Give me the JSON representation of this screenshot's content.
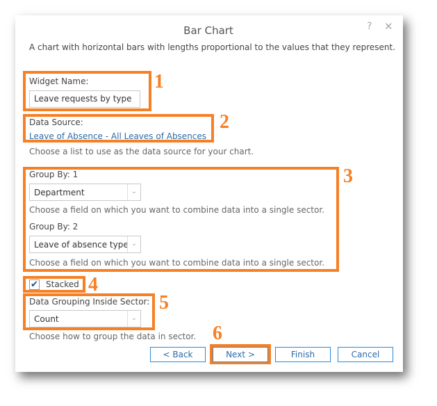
{
  "dialog": {
    "title": "Bar Chart",
    "description": "A chart with horizontal bars with lengths proportional to the values that they represent.",
    "help_icon": "?",
    "close_icon": "✕"
  },
  "widget_name": {
    "label": "Widget Name:",
    "value": "Leave requests by type"
  },
  "data_source": {
    "label": "Data Source:",
    "link": "Leave of Absence - All Leaves of Absences",
    "help": "Choose a list to use as the data source for your chart."
  },
  "group_by_1": {
    "label": "Group By: 1",
    "value": "Department",
    "help": "Choose a field on which you want to combine data into a single sector."
  },
  "group_by_2": {
    "label": "Group By: 2",
    "value": "Leave of absence type",
    "help": "Choose a field on which you want to combine data into a single sector."
  },
  "stacked": {
    "label": "Stacked",
    "checked": true
  },
  "grouping": {
    "label": "Data Grouping Inside Sector:",
    "value": "Count",
    "help": "Choose how to group the data in sector."
  },
  "buttons": {
    "back": "< Back",
    "next": "Next >",
    "finish": "Finish",
    "cancel": "Cancel"
  },
  "callouts": [
    "1",
    "2",
    "3",
    "4",
    "5",
    "6"
  ],
  "accent": "#f68026",
  "link_color": "#2b6aa8"
}
